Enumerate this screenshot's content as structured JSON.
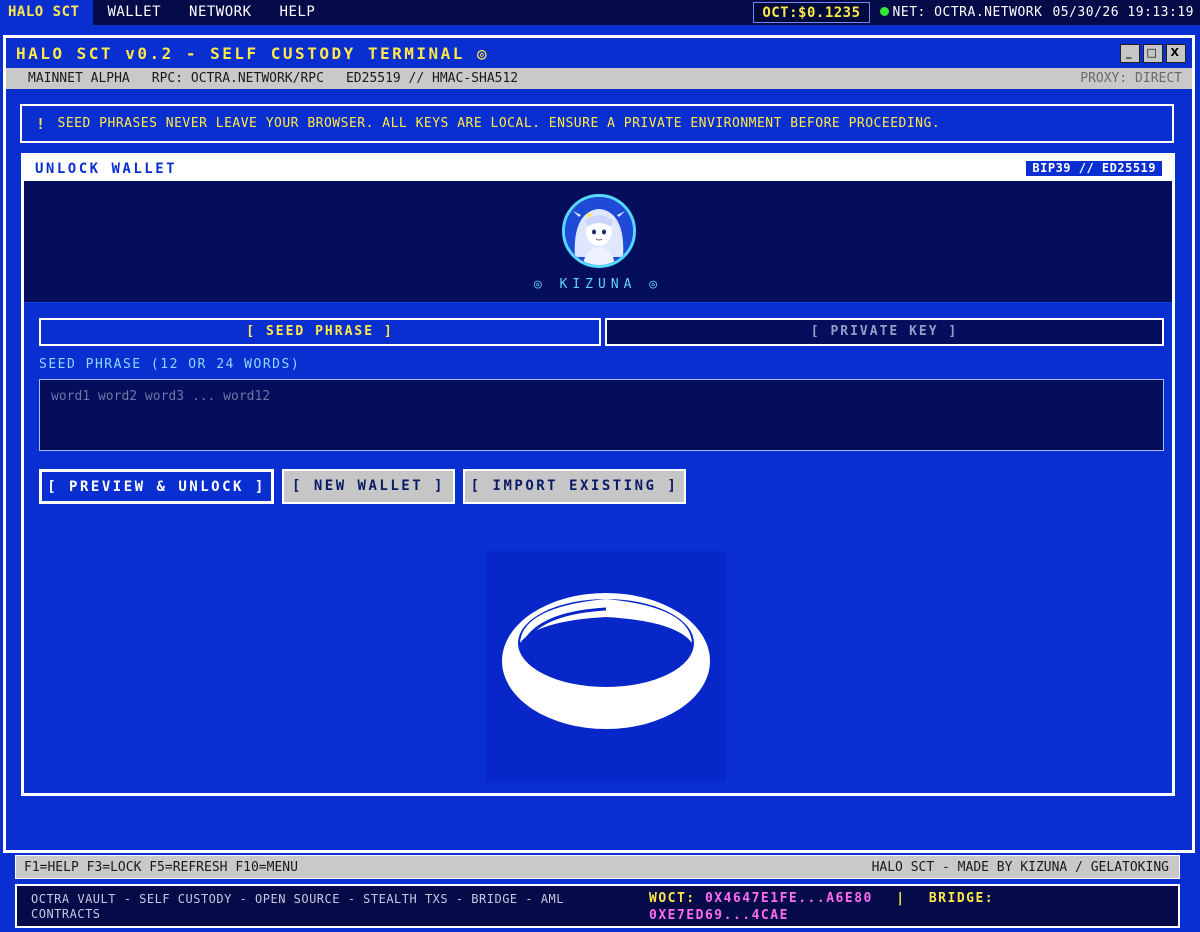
{
  "menubar": {
    "brand": "HALO SCT",
    "items": [
      "WALLET",
      "NETWORK",
      "HELP"
    ],
    "price": "OCT:$0.1235",
    "network": "NET: OCTRA.NETWORK",
    "datetime": "05/30/26 19:13:19"
  },
  "window": {
    "title": "HALO SCT v0.2 - SELF CUSTODY TERMINAL ◎",
    "controls": [
      "_",
      "□",
      "X"
    ],
    "status": {
      "network": "MAINNET ALPHA",
      "rpc": "RPC: OCTRA.NETWORK/RPC",
      "crypto": "ED25519 // HMAC-SHA512",
      "proxy": "PROXY: DIRECT"
    }
  },
  "warning": {
    "icon": "!",
    "text": "SEED PHRASES NEVER LEAVE YOUR BROWSER. ALL KEYS ARE LOCAL. ENSURE A PRIVATE ENVIRONMENT BEFORE PROCEEDING."
  },
  "unlock": {
    "title": "UNLOCK WALLET",
    "tag": "BIP39 // ED25519",
    "avatar_name": "◎ KIZUNA ◎",
    "tabs": {
      "seed": "[ SEED PHRASE ]",
      "private_key": "[ PRIVATE KEY ]"
    },
    "field_label": "SEED PHRASE (12 OR 24 WORDS)",
    "placeholder": "word1 word2 word3 ... word12",
    "buttons": {
      "preview": "[ PREVIEW & UNLOCK ]",
      "new_wallet": "[ NEW WALLET ]",
      "import": "[ IMPORT EXISTING ]"
    }
  },
  "fkeys": {
    "keys": "F1=HELP F3=LOCK F5=REFRESH F10=MENU",
    "credit": "HALO SCT - MADE BY KIZUNA / GELATOKING"
  },
  "footer": {
    "features": "OCTRA VAULT - SELF CUSTODY - OPEN SOURCE - STEALTH TXS - BRIDGE - AML CONTRACTS",
    "woct_label": "WOCT:",
    "woct_value": "0X4647E1FE...A6E80",
    "separator": "|",
    "bridge_label": "BRIDGE:",
    "bridge_value": "0XE7ED69...4CAE"
  },
  "colors": {
    "background": "#0a2fd0",
    "accent_yellow": "#ffe94a",
    "accent_cyan": "#5fd2ff",
    "accent_pink": "#ff6cf0",
    "status_green": "#35e83a"
  }
}
